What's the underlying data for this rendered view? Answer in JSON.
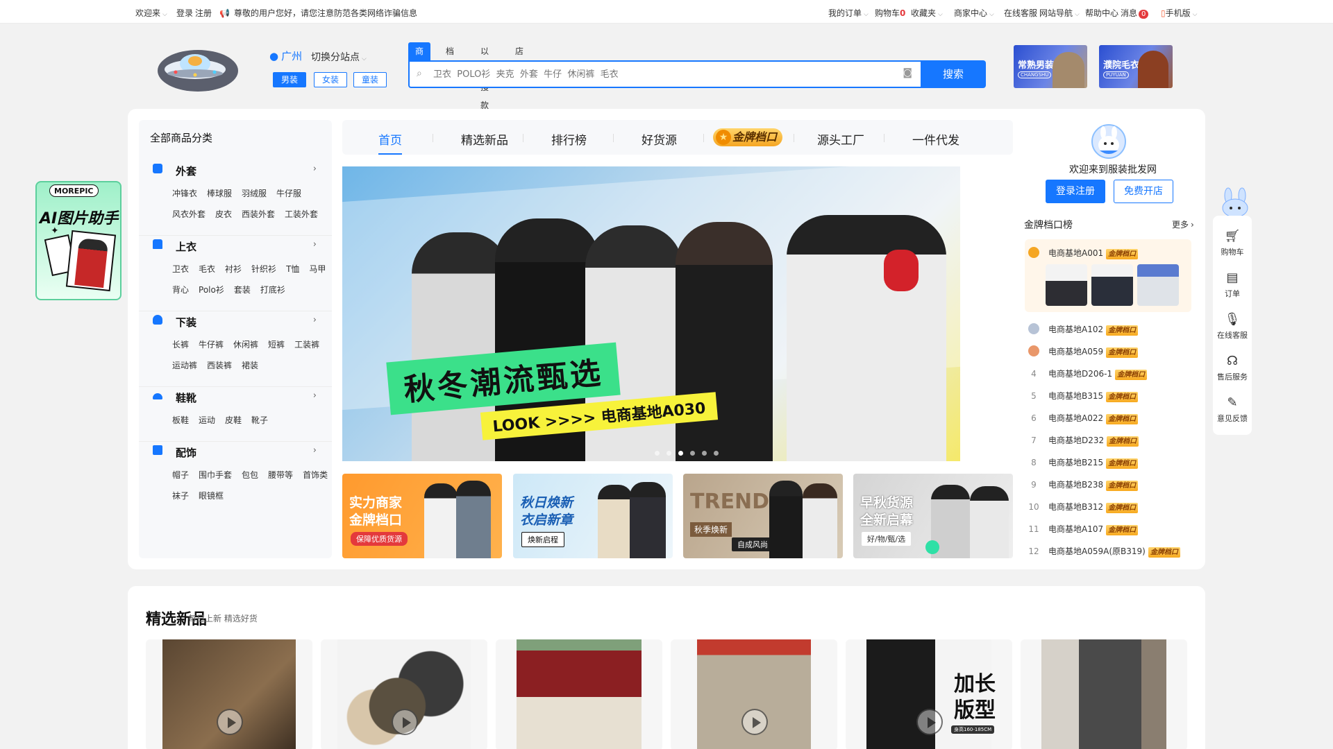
{
  "topbar": {
    "left_menu": "欢迎来",
    "login": "登录",
    "register": "注册",
    "notice": "尊敬的用户您好，请您注意防范各类网络诈骗信息",
    "right": [
      {
        "label": "我的订单",
        "caret": true
      },
      {
        "label": "购物车",
        "count": "0"
      },
      {
        "label": "收藏夹",
        "caret": true
      },
      {
        "label": "商家中心",
        "caret": true
      },
      {
        "label": "在线客服"
      },
      {
        "label": "网站导航",
        "caret": true
      },
      {
        "label": "帮助中心"
      },
      {
        "label": "消息",
        "badge": "0"
      },
      {
        "label": "手机版",
        "caret": true
      }
    ]
  },
  "header": {
    "location": "广州",
    "site_select": "切换分站点",
    "category_buttons": [
      "男装",
      "女装",
      "童装"
    ],
    "search_tabs": [
      "商品",
      "档口",
      "以图搜款",
      "店铺"
    ],
    "search_placeholder": "卫衣  POLO衫  夹克  外套  牛仔  休闲裤  毛衣",
    "search_button": "搜索",
    "ads": [
      {
        "title": "常熟男装",
        "tag": "CHANGSHU"
      },
      {
        "title": "濮院毛衣",
        "tag": "PUYUAN"
      }
    ]
  },
  "categories": {
    "title": "全部商品分类",
    "items": [
      {
        "name": "外套",
        "rows": [
          [
            "冲锋衣",
            "棒球服",
            "羽绒服",
            "牛仔服"
          ],
          [
            "风衣外套",
            "皮衣",
            "西装外套",
            "工装外套"
          ]
        ]
      },
      {
        "name": "上衣",
        "rows": [
          [
            "卫衣",
            "毛衣",
            "衬衫",
            "针织衫",
            "T恤",
            "马甲"
          ],
          [
            "背心",
            "Polo衫",
            "套装",
            "打底衫"
          ]
        ]
      },
      {
        "name": "下装",
        "rows": [
          [
            "长裤",
            "牛仔裤",
            "休闲裤",
            "短裤",
            "工装裤"
          ],
          [
            "运动裤",
            "西装裤",
            "裙装"
          ]
        ]
      },
      {
        "name": "鞋靴",
        "rows": [
          [
            "板鞋",
            "运动",
            "皮鞋",
            "靴子"
          ]
        ]
      },
      {
        "name": "配饰",
        "rows": [
          [
            "帽子",
            "围巾手套",
            "包包",
            "腰带等",
            "首饰类"
          ],
          [
            "袜子",
            "眼镜框"
          ]
        ]
      }
    ]
  },
  "nav": {
    "items": [
      "首页",
      "精选新品",
      "排行榜",
      "好货源",
      "金牌档口",
      "源头工厂",
      "一件代发"
    ]
  },
  "banner": {
    "headline": "秋冬潮流甄选",
    "subline": "LOOK >>>> 电商基地A030",
    "slides": 6,
    "active_slide": 2
  },
  "promos": [
    {
      "line1": "实力商家",
      "line2": "金牌档口",
      "badge": "保障优质货源"
    },
    {
      "line1": "秋日焕新",
      "line2": "衣启新章",
      "badge": "焕新启程"
    },
    {
      "line1": "TREND",
      "line2": "秋季焕新",
      "badge": "自成风尚"
    },
    {
      "line1": "早秋货源",
      "line2": "全新启幕",
      "badge": "好/物/甄/选"
    }
  ],
  "account": {
    "welcome": "欢迎来到服装批发网",
    "login_button": "登录注册",
    "register_button": "免费开店"
  },
  "ranking": {
    "title": "金牌档口榜",
    "more": "更多",
    "badge_label": "金牌档口",
    "items": [
      "电商基地A001",
      "电商基地A102",
      "电商基地A059",
      "电商基地D206-1",
      "电商基地B315",
      "电商基地A022",
      "电商基地D232",
      "电商基地B215",
      "电商基地B238",
      "电商基地B312",
      "电商基地A107",
      "电商基地A059A(原B319)"
    ]
  },
  "ai_card": {
    "brand": "MOREPIC",
    "title": "AI图片助手"
  },
  "sidebar": {
    "items": [
      {
        "label": "购物车",
        "icon": "cart-icon"
      },
      {
        "label": "订单",
        "icon": "order-icon"
      },
      {
        "label": "在线客服",
        "icon": "mic-icon"
      },
      {
        "label": "售后服务",
        "icon": "service-icon"
      },
      {
        "label": "意见反馈",
        "icon": "edit-icon"
      }
    ]
  },
  "section2": {
    "title": "精选新品",
    "subtitle": "每日上新 精选好货",
    "overlay_text": "加长 版型",
    "overlay_tag": "身高160-185CM"
  },
  "colors": {
    "brand": "#1677ff",
    "gold": "#f5a623",
    "red": "#e4393c"
  }
}
